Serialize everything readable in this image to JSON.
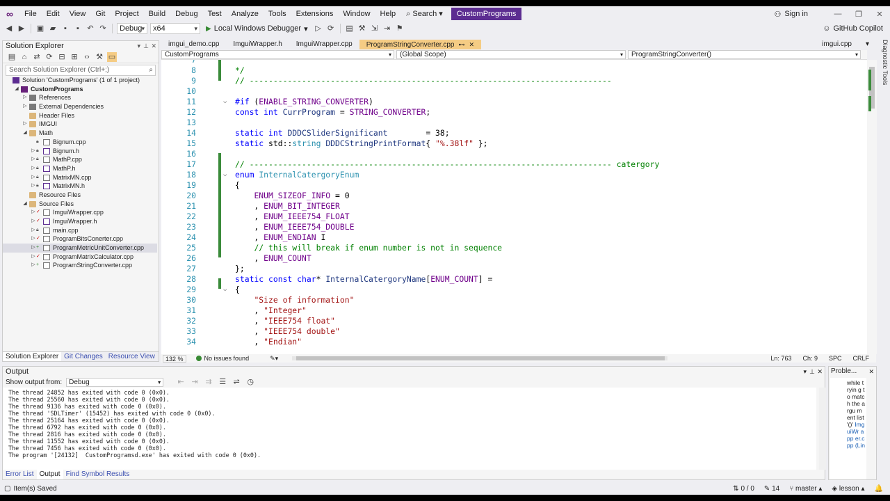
{
  "menu": {
    "items": [
      "File",
      "Edit",
      "View",
      "Git",
      "Project",
      "Build",
      "Debug",
      "Test",
      "Analyze",
      "Tools",
      "Extensions",
      "Window",
      "Help"
    ],
    "search_label": "Search",
    "solution_name": "CustomPrograms",
    "signin": "Sign in"
  },
  "toolbar": {
    "config": "Debug",
    "platform": "x64",
    "run_label": "Local Windows Debugger",
    "copilot": "GitHub Copilot"
  },
  "solution_explorer": {
    "title": "Solution Explorer",
    "search_placeholder": "Search Solution Explorer (Ctrl+;)",
    "tree": [
      {
        "label": "Solution 'CustomPrograms' (1 of 1 project)",
        "depth": 0,
        "icon": "sln",
        "arrow": ""
      },
      {
        "label": "CustomPrograms",
        "depth": 1,
        "icon": "proj",
        "arrow": "◢",
        "bold": true
      },
      {
        "label": "References",
        "depth": 2,
        "icon": "ref",
        "arrow": "▷"
      },
      {
        "label": "External Dependencies",
        "depth": 2,
        "icon": "ref",
        "arrow": "▷"
      },
      {
        "label": "Header Files",
        "depth": 2,
        "icon": "folder",
        "arrow": ""
      },
      {
        "label": "IMGUI",
        "depth": 2,
        "icon": "folder",
        "arrow": "▷"
      },
      {
        "label": "Math",
        "depth": 2,
        "icon": "folder",
        "arrow": "◢"
      },
      {
        "label": "Bignum.cpp",
        "depth": 3,
        "icon": "cpp",
        "arrow": "",
        "mark": "a"
      },
      {
        "label": "Bignum.h",
        "depth": 3,
        "icon": "h",
        "arrow": "▷",
        "mark": "a"
      },
      {
        "label": "MathP.cpp",
        "depth": 3,
        "icon": "cpp",
        "arrow": "▷",
        "mark": "a"
      },
      {
        "label": "MathP.h",
        "depth": 3,
        "icon": "h",
        "arrow": "▷",
        "mark": "a"
      },
      {
        "label": "MatrixMN.cpp",
        "depth": 3,
        "icon": "cpp",
        "arrow": "▷",
        "mark": "a"
      },
      {
        "label": "MatrixMN.h",
        "depth": 3,
        "icon": "h",
        "arrow": "▷",
        "mark": "a"
      },
      {
        "label": "Resource Files",
        "depth": 2,
        "icon": "folder",
        "arrow": ""
      },
      {
        "label": "Source Files",
        "depth": 2,
        "icon": "folder",
        "arrow": "◢"
      },
      {
        "label": "ImguiWrapper.cpp",
        "depth": 3,
        "icon": "cpp",
        "arrow": "▷",
        "mark": "✓"
      },
      {
        "label": "ImguiWrapper.h",
        "depth": 3,
        "icon": "h",
        "arrow": "▷",
        "mark": "✓"
      },
      {
        "label": "main.cpp",
        "depth": 3,
        "icon": "cpp",
        "arrow": "▷",
        "mark": "a"
      },
      {
        "label": "ProgramBitsConerter.cpp",
        "depth": 3,
        "icon": "cpp",
        "arrow": "▷",
        "mark": "✓"
      },
      {
        "label": "ProgramMetricUnitConverter.cpp",
        "depth": 3,
        "icon": "cpp",
        "arrow": "▷",
        "mark": "+",
        "selected": true
      },
      {
        "label": "ProgramMatrixCalculator.cpp",
        "depth": 3,
        "icon": "cpp",
        "arrow": "▷",
        "mark": "✓"
      },
      {
        "label": "ProgramStringConverter.cpp",
        "depth": 3,
        "icon": "cpp",
        "arrow": "▷",
        "mark": "+"
      }
    ],
    "bottom_tabs": [
      "Solution Explorer",
      "Git Changes",
      "Resource View"
    ]
  },
  "editor": {
    "tabs": [
      "imgui_demo.cpp",
      "ImguiWrapper.h",
      "ImguiWrapper.cpp",
      "ProgramStringConverter.cpp"
    ],
    "active_tab": "ProgramStringConverter.cpp",
    "right_tab": "imgui.cpp",
    "nav": {
      "project": "CustomPrograms",
      "scope": "(Global Scope)",
      "member": "ProgramStringConverter()"
    },
    "lines": [
      {
        "n": "7",
        "html": "",
        "fold": ""
      },
      {
        "n": "8",
        "parts": [
          [
            "cm",
            "*/"
          ]
        ]
      },
      {
        "n": "9",
        "parts": [
          [
            "cm",
            "// ----------------------------------------------------------------------------"
          ]
        ]
      },
      {
        "n": "10",
        "parts": []
      },
      {
        "n": "11",
        "fold": "⌵",
        "parts": [
          [
            "kw",
            "#if"
          ],
          [
            "",
            " ("
          ],
          [
            "mac",
            "ENABLE_STRING_CONVERTER"
          ],
          [
            "",
            ")"
          ]
        ]
      },
      {
        "n": "12",
        "parts": [
          [
            "kw",
            "const int"
          ],
          [
            "",
            " "
          ],
          [
            "ident",
            "CurrProgram"
          ],
          [
            "",
            " = "
          ],
          [
            "mac",
            "STRING_CONVERTER"
          ],
          [
            "",
            ";"
          ]
        ]
      },
      {
        "n": "13",
        "parts": []
      },
      {
        "n": "14",
        "parts": [
          [
            "kw",
            "static int"
          ],
          [
            "",
            " "
          ],
          [
            "ident",
            "DDDCSliderSignificant"
          ],
          [
            "",
            "        = 38;"
          ]
        ]
      },
      {
        "n": "15",
        "parts": [
          [
            "kw",
            "static"
          ],
          [
            "",
            " std::"
          ],
          [
            "ty",
            "string"
          ],
          [
            "",
            " "
          ],
          [
            "ident",
            "DDDCStringPrintFormat"
          ],
          [
            "",
            "{ "
          ],
          [
            "st",
            "\"%.38lf\""
          ],
          [
            "",
            " };"
          ]
        ]
      },
      {
        "n": "16",
        "parts": []
      },
      {
        "n": "17",
        "parts": [
          [
            "cm",
            "// ---------------------------------------------------------------------------- catergory"
          ]
        ]
      },
      {
        "n": "18",
        "fold": "⌵",
        "parts": [
          [
            "kw",
            "enum"
          ],
          [
            "",
            " "
          ],
          [
            "ty",
            "InternalCatergoryEnum"
          ]
        ]
      },
      {
        "n": "19",
        "parts": [
          [
            "",
            "{"
          ]
        ]
      },
      {
        "n": "20",
        "parts": [
          [
            "",
            "    "
          ],
          [
            "mac",
            "ENUM_SIZEOF_INFO"
          ],
          [
            "",
            " = 0"
          ]
        ]
      },
      {
        "n": "21",
        "parts": [
          [
            "",
            "    , "
          ],
          [
            "mac",
            "ENUM_BIT_INTEGER"
          ]
        ]
      },
      {
        "n": "22",
        "parts": [
          [
            "",
            "    , "
          ],
          [
            "mac",
            "ENUM_IEEE754_FLOAT"
          ]
        ]
      },
      {
        "n": "23",
        "parts": [
          [
            "",
            "    , "
          ],
          [
            "mac",
            "ENUM_IEEE754_DOUBLE"
          ]
        ]
      },
      {
        "n": "24",
        "parts": [
          [
            "",
            "    , "
          ],
          [
            "mac",
            "ENUM_ENDIAN"
          ],
          [
            "",
            " I"
          ]
        ]
      },
      {
        "n": "25",
        "parts": [
          [
            "",
            "    "
          ],
          [
            "cm",
            "// this will break if enum number is not in sequence"
          ]
        ]
      },
      {
        "n": "26",
        "parts": [
          [
            "",
            "    , "
          ],
          [
            "mac",
            "ENUM_COUNT"
          ]
        ]
      },
      {
        "n": "27",
        "parts": [
          [
            "",
            "};"
          ]
        ]
      },
      {
        "n": "28",
        "parts": [
          [
            "kw",
            "static const char"
          ],
          [
            "",
            "* "
          ],
          [
            "ident",
            "InternalCatergoryName"
          ],
          [
            "",
            "["
          ],
          [
            "mac",
            "ENUM_COUNT"
          ],
          [
            "",
            "] ="
          ]
        ]
      },
      {
        "n": "29",
        "fold": "⌵",
        "parts": [
          [
            "",
            "{"
          ]
        ]
      },
      {
        "n": "30",
        "parts": [
          [
            "",
            "    "
          ],
          [
            "st",
            "\"Size of information\""
          ]
        ]
      },
      {
        "n": "31",
        "parts": [
          [
            "",
            "    , "
          ],
          [
            "st",
            "\"Integer\""
          ]
        ]
      },
      {
        "n": "32",
        "parts": [
          [
            "",
            "    , "
          ],
          [
            "st",
            "\"IEEE754 float\""
          ]
        ]
      },
      {
        "n": "33",
        "parts": [
          [
            "",
            "    , "
          ],
          [
            "st",
            "\"IEEE754 double\""
          ]
        ]
      },
      {
        "n": "34",
        "parts": [
          [
            "",
            "    , "
          ],
          [
            "st",
            "\"Endian\""
          ]
        ]
      }
    ],
    "status": {
      "zoom": "132 %",
      "issues": "No issues found",
      "ln": "Ln: 763",
      "ch": "Ch: 9",
      "spc": "SPC",
      "crlf": "CRLF"
    }
  },
  "output": {
    "title": "Output",
    "show_from_label": "Show output from:",
    "source": "Debug",
    "lines": [
      "The thread 24852 has exited with code 0 (0x0).",
      "The thread 25560 has exited with code 0 (0x0).",
      "The thread 9136 has exited with code 0 (0x0).",
      "The thread 'SDLTimer' (15452) has exited with code 0 (0x0).",
      "The thread 25164 has exited with code 0 (0x0).",
      "The thread 6792 has exited with code 0 (0x0).",
      "The thread 2816 has exited with code 0 (0x0).",
      "The thread 11552 has exited with code 0 (0x0).",
      "The thread 7456 has exited with code 0 (0x0).",
      "The program '[24132]  CustomProgramsd.exe' has exited with code 0 (0x0)."
    ],
    "tabs": [
      "Error List",
      "Output",
      "Find Symbol Results"
    ]
  },
  "problems": {
    "title": "Proble...",
    "text": "while tryin g to matc h the argu ment list '()'",
    "link": "Img uiWr app er.c pp (Lin"
  },
  "diag_tab": "Diagnostic Tools",
  "statusbar": {
    "saved": "Item(s) Saved",
    "updown": "0 / 0",
    "count": "14",
    "branch": "master",
    "repo": "lesson"
  }
}
